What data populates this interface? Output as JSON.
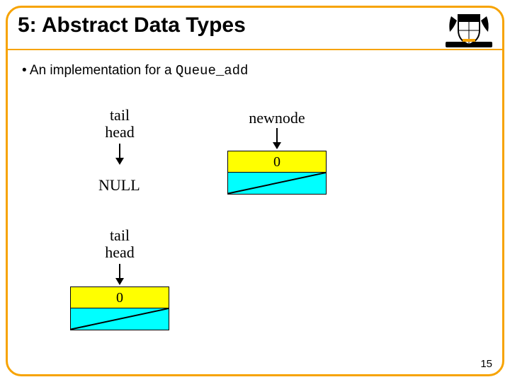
{
  "title": "5: Abstract Data Types",
  "bullet_prefix": "An implementation for a ",
  "bullet_code": "Queue_add",
  "labels": {
    "tail": "tail",
    "head": "head",
    "newnode": "newnode",
    "null": "NULL"
  },
  "node_value": "0",
  "page_number": "15",
  "logo_name": "princeton-shield-logo"
}
